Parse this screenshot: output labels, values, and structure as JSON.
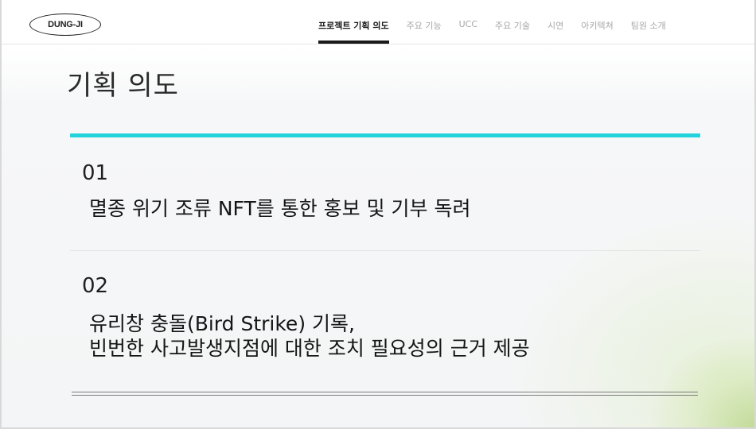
{
  "header": {
    "logo_text": "DUNG-JI",
    "nav": [
      {
        "label": "프로젝트 기획 의도",
        "active": true
      },
      {
        "label": "주요 기능",
        "active": false
      },
      {
        "label": "UCC",
        "active": false
      },
      {
        "label": "주요 기술",
        "active": false
      },
      {
        "label": "시연",
        "active": false
      },
      {
        "label": "아키텍쳐",
        "active": false
      },
      {
        "label": "팀원 소개",
        "active": false
      }
    ]
  },
  "main": {
    "title": "기획 의도",
    "accent_color": "#22d3db",
    "items": [
      {
        "number": "01",
        "lines": [
          "멸종 위기 조류 NFT를 통한 홍보 및 기부 독려"
        ]
      },
      {
        "number": "02",
        "lines": [
          "유리창 충돌(Bird Strike) 기록,",
          "빈번한 사고발생지점에 대한 조치 필요성의 근거 제공"
        ]
      }
    ]
  }
}
